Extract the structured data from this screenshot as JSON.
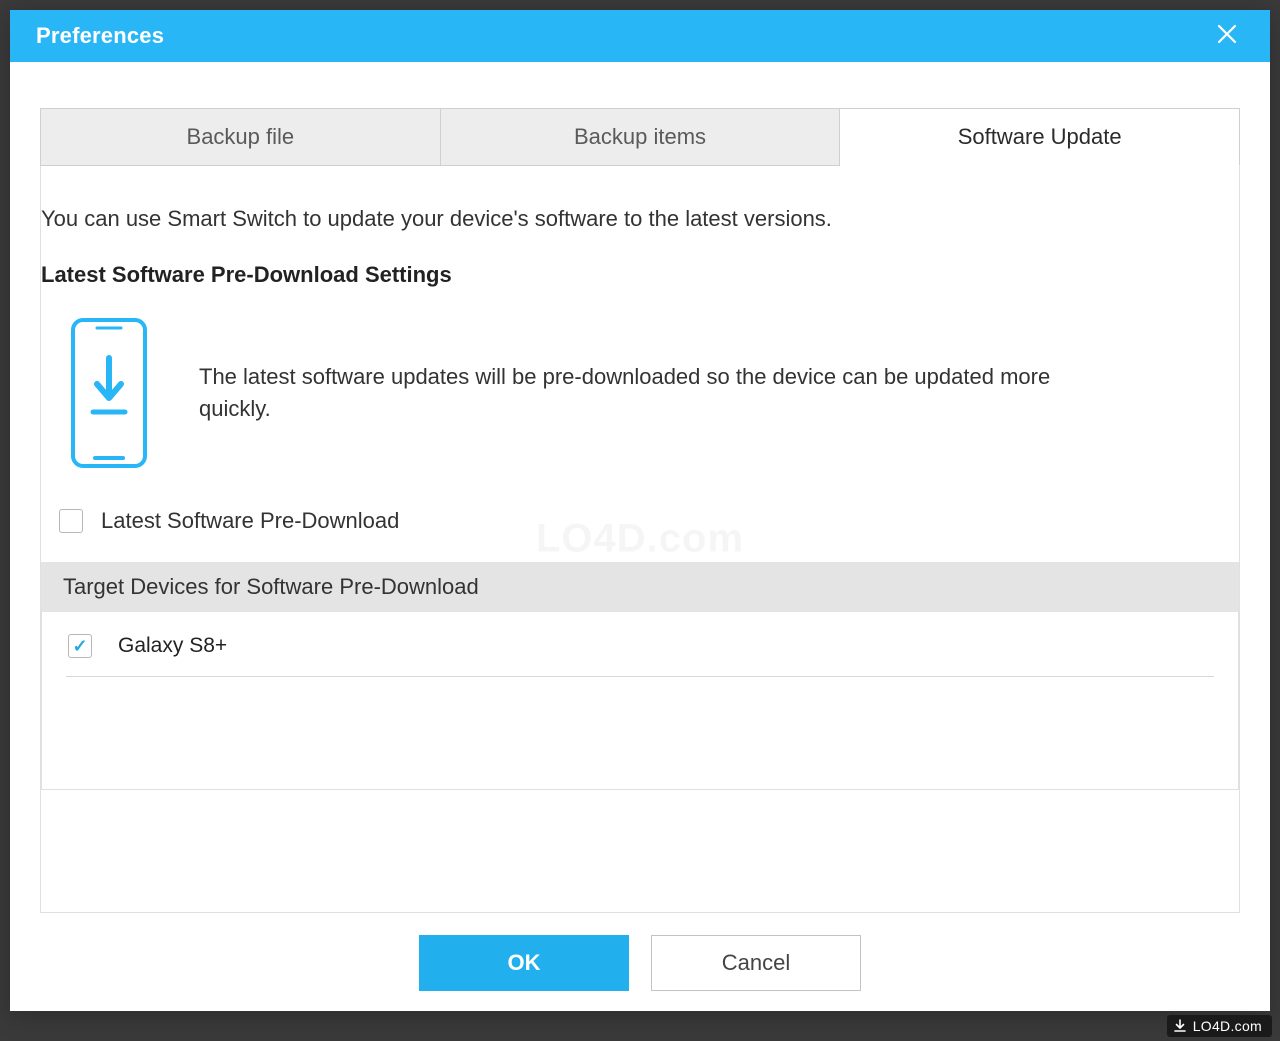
{
  "window": {
    "title": "Preferences"
  },
  "tabs": [
    {
      "label": "Backup file",
      "active": false
    },
    {
      "label": "Backup items",
      "active": false
    },
    {
      "label": "Software Update",
      "active": true
    }
  ],
  "page": {
    "intro": "You can use Smart Switch to update your device's software to the latest versions.",
    "subheading": "Latest Software Pre-Download Settings",
    "promo_text": "The latest software updates will be pre-downloaded so the device can be updated more quickly.",
    "predownload_checkbox": {
      "label": "Latest Software Pre-Download",
      "checked": false
    },
    "devices_section_label": "Target Devices for Software Pre-Download",
    "devices": [
      {
        "name": "Galaxy S8+",
        "checked": true
      }
    ]
  },
  "buttons": {
    "ok": "OK",
    "cancel": "Cancel"
  },
  "attribution": "LO4D.com",
  "watermark": "LO4D.com",
  "colors": {
    "accent": "#29b6f6",
    "primary_button": "#21b0ed"
  }
}
